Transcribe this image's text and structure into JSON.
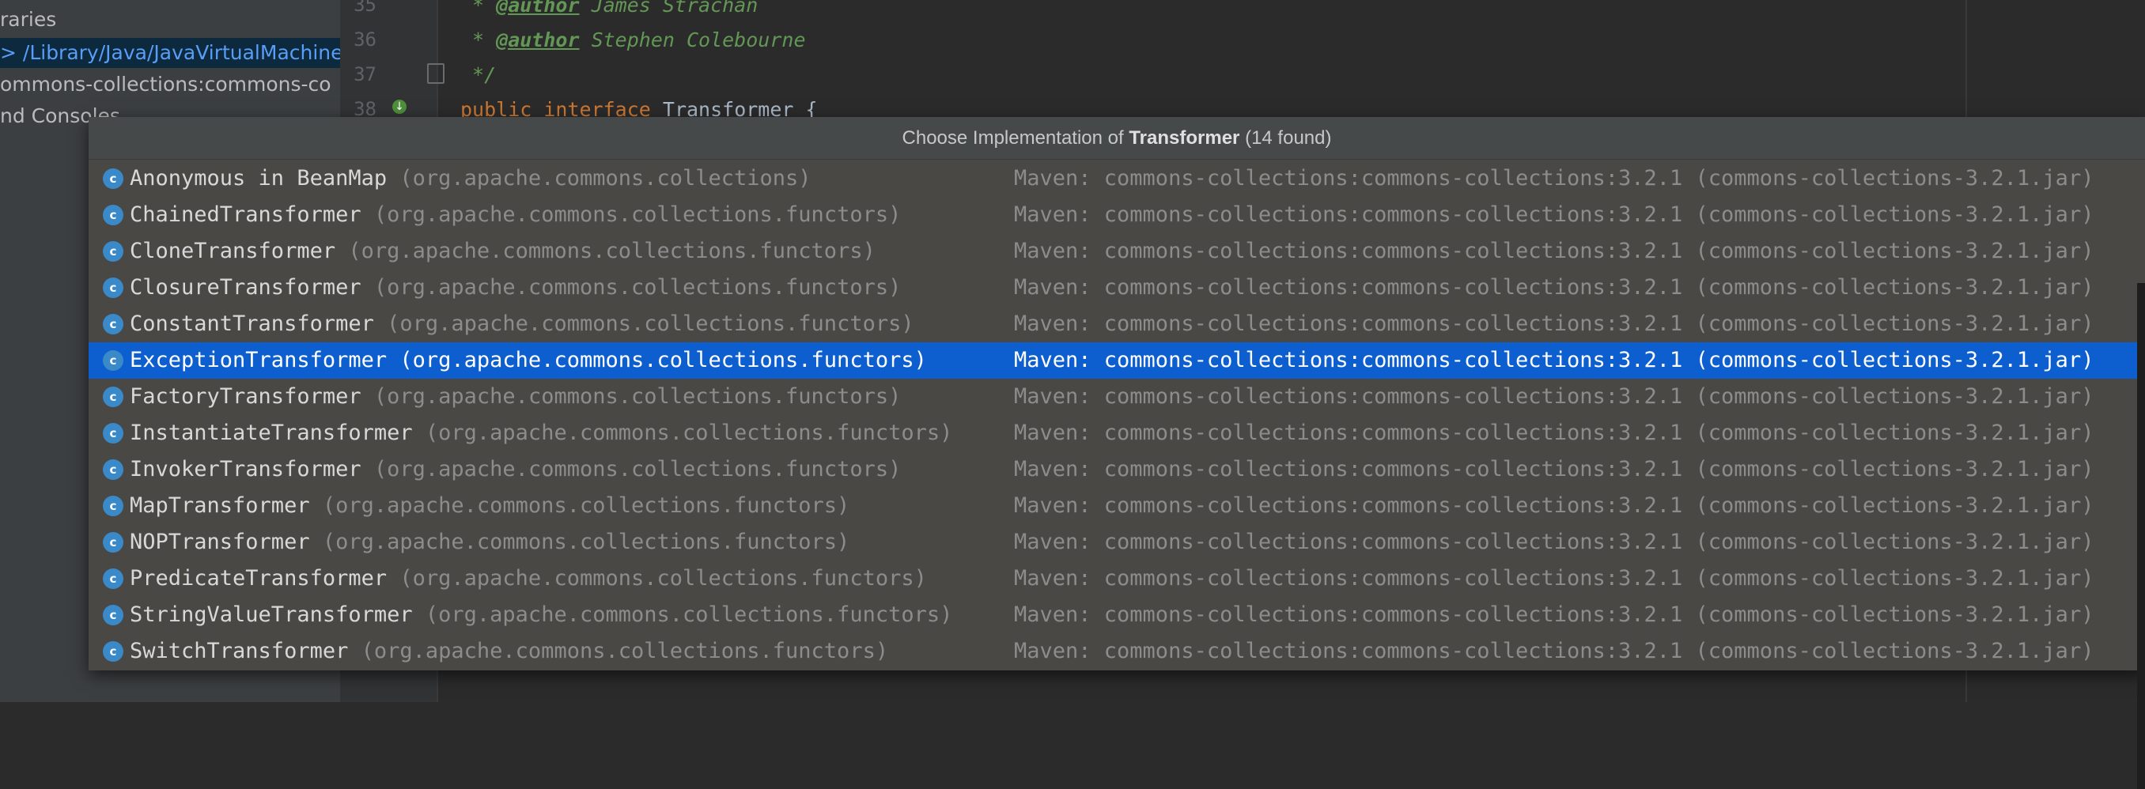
{
  "left_panel": {
    "rows": [
      "raries",
      "> /Library/Java/JavaVirtualMachine",
      "ommons-collections:commons-co",
      "nd Consoles"
    ]
  },
  "editor": {
    "line_numbers": [
      "35",
      "36",
      "37",
      "38"
    ],
    "line35_tag": "@author",
    "line35_text": " James Strachan",
    "line36_tag": "@author",
    "line36_text": " Stephen Colebourne",
    "line37_text": " */",
    "line38_kw1": "public",
    "line38_kw2": "interface",
    "line38_rest": " Transformer {"
  },
  "popup": {
    "title_prefix": "Choose Implementation of ",
    "title_bold": "Transformer",
    "title_suffix": " (14 found)",
    "items": [
      {
        "name": "Anonymous in BeanMap",
        "pkg": "(org.apache.commons.collections)",
        "loc": "Maven: commons-collections:commons-collections:3.2.1 (commons-collections-3.2.1.jar)"
      },
      {
        "name": "ChainedTransformer",
        "pkg": "(org.apache.commons.collections.functors)",
        "loc": "Maven: commons-collections:commons-collections:3.2.1 (commons-collections-3.2.1.jar)"
      },
      {
        "name": "CloneTransformer",
        "pkg": "(org.apache.commons.collections.functors)",
        "loc": "Maven: commons-collections:commons-collections:3.2.1 (commons-collections-3.2.1.jar)"
      },
      {
        "name": "ClosureTransformer",
        "pkg": "(org.apache.commons.collections.functors)",
        "loc": "Maven: commons-collections:commons-collections:3.2.1 (commons-collections-3.2.1.jar)"
      },
      {
        "name": "ConstantTransformer",
        "pkg": "(org.apache.commons.collections.functors)",
        "loc": "Maven: commons-collections:commons-collections:3.2.1 (commons-collections-3.2.1.jar)"
      },
      {
        "name": "ExceptionTransformer",
        "pkg": "(org.apache.commons.collections.functors)",
        "loc": "Maven: commons-collections:commons-collections:3.2.1 (commons-collections-3.2.1.jar)"
      },
      {
        "name": "FactoryTransformer",
        "pkg": "(org.apache.commons.collections.functors)",
        "loc": "Maven: commons-collections:commons-collections:3.2.1 (commons-collections-3.2.1.jar)"
      },
      {
        "name": "InstantiateTransformer",
        "pkg": "(org.apache.commons.collections.functors)",
        "loc": "Maven: commons-collections:commons-collections:3.2.1 (commons-collections-3.2.1.jar)"
      },
      {
        "name": "InvokerTransformer",
        "pkg": "(org.apache.commons.collections.functors)",
        "loc": "Maven: commons-collections:commons-collections:3.2.1 (commons-collections-3.2.1.jar)"
      },
      {
        "name": "MapTransformer",
        "pkg": "(org.apache.commons.collections.functors)",
        "loc": "Maven: commons-collections:commons-collections:3.2.1 (commons-collections-3.2.1.jar)"
      },
      {
        "name": "NOPTransformer",
        "pkg": "(org.apache.commons.collections.functors)",
        "loc": "Maven: commons-collections:commons-collections:3.2.1 (commons-collections-3.2.1.jar)"
      },
      {
        "name": "PredicateTransformer",
        "pkg": "(org.apache.commons.collections.functors)",
        "loc": "Maven: commons-collections:commons-collections:3.2.1 (commons-collections-3.2.1.jar)"
      },
      {
        "name": "StringValueTransformer",
        "pkg": "(org.apache.commons.collections.functors)",
        "loc": "Maven: commons-collections:commons-collections:3.2.1 (commons-collections-3.2.1.jar)"
      },
      {
        "name": "SwitchTransformer",
        "pkg": "(org.apache.commons.collections.functors)",
        "loc": "Maven: commons-collections:commons-collections:3.2.1 (commons-collections-3.2.1.jar)"
      }
    ],
    "icon_letter": "c"
  }
}
